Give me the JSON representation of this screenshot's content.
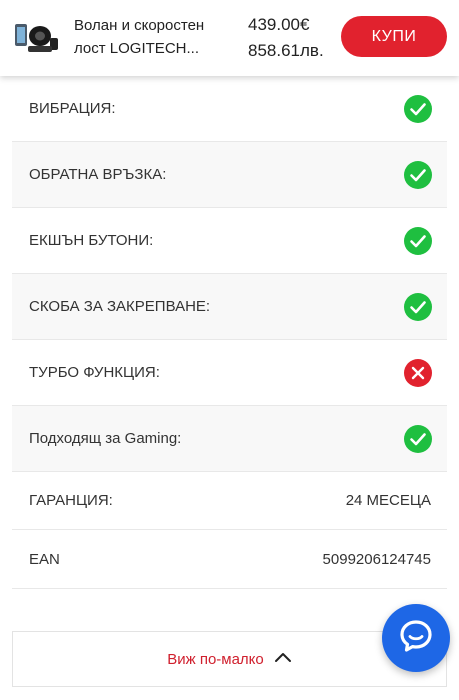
{
  "header": {
    "product_title_line1": "Волан и скоростен",
    "product_title_line2": "лост LOGITECH...",
    "price_eur": "439.00€",
    "price_bgn": "858.61лв.",
    "buy_label": "КУПИ"
  },
  "specs": [
    {
      "label": "ВИБРАЦИЯ:",
      "status": "yes"
    },
    {
      "label": "ОБРАТНА ВРЪЗКА:",
      "status": "yes"
    },
    {
      "label": "ЕКШЪН БУТОНИ:",
      "status": "yes"
    },
    {
      "label": "СКОБА ЗА ЗАКРЕПВАНЕ:",
      "status": "yes"
    },
    {
      "label": "ТУРБО ФУНКЦИЯ:",
      "status": "no"
    },
    {
      "label": "Подходящ за Gaming:",
      "status": "yes"
    },
    {
      "label": "ГАРАНЦИЯ:",
      "value": "24 МЕСЕЦА"
    },
    {
      "label": "EAN",
      "value": "5099206124745"
    }
  ],
  "show_less_label": "Виж по-малко",
  "colors": {
    "accent_red": "#e1222e",
    "check_green": "#1fbf40",
    "cross_red": "#e1222e",
    "chat_blue": "#1e67e6"
  },
  "icons": {
    "yes": "check-circle-icon",
    "no": "x-circle-icon",
    "chat": "chat-bubble-icon",
    "collapse": "chevron-up-icon"
  }
}
